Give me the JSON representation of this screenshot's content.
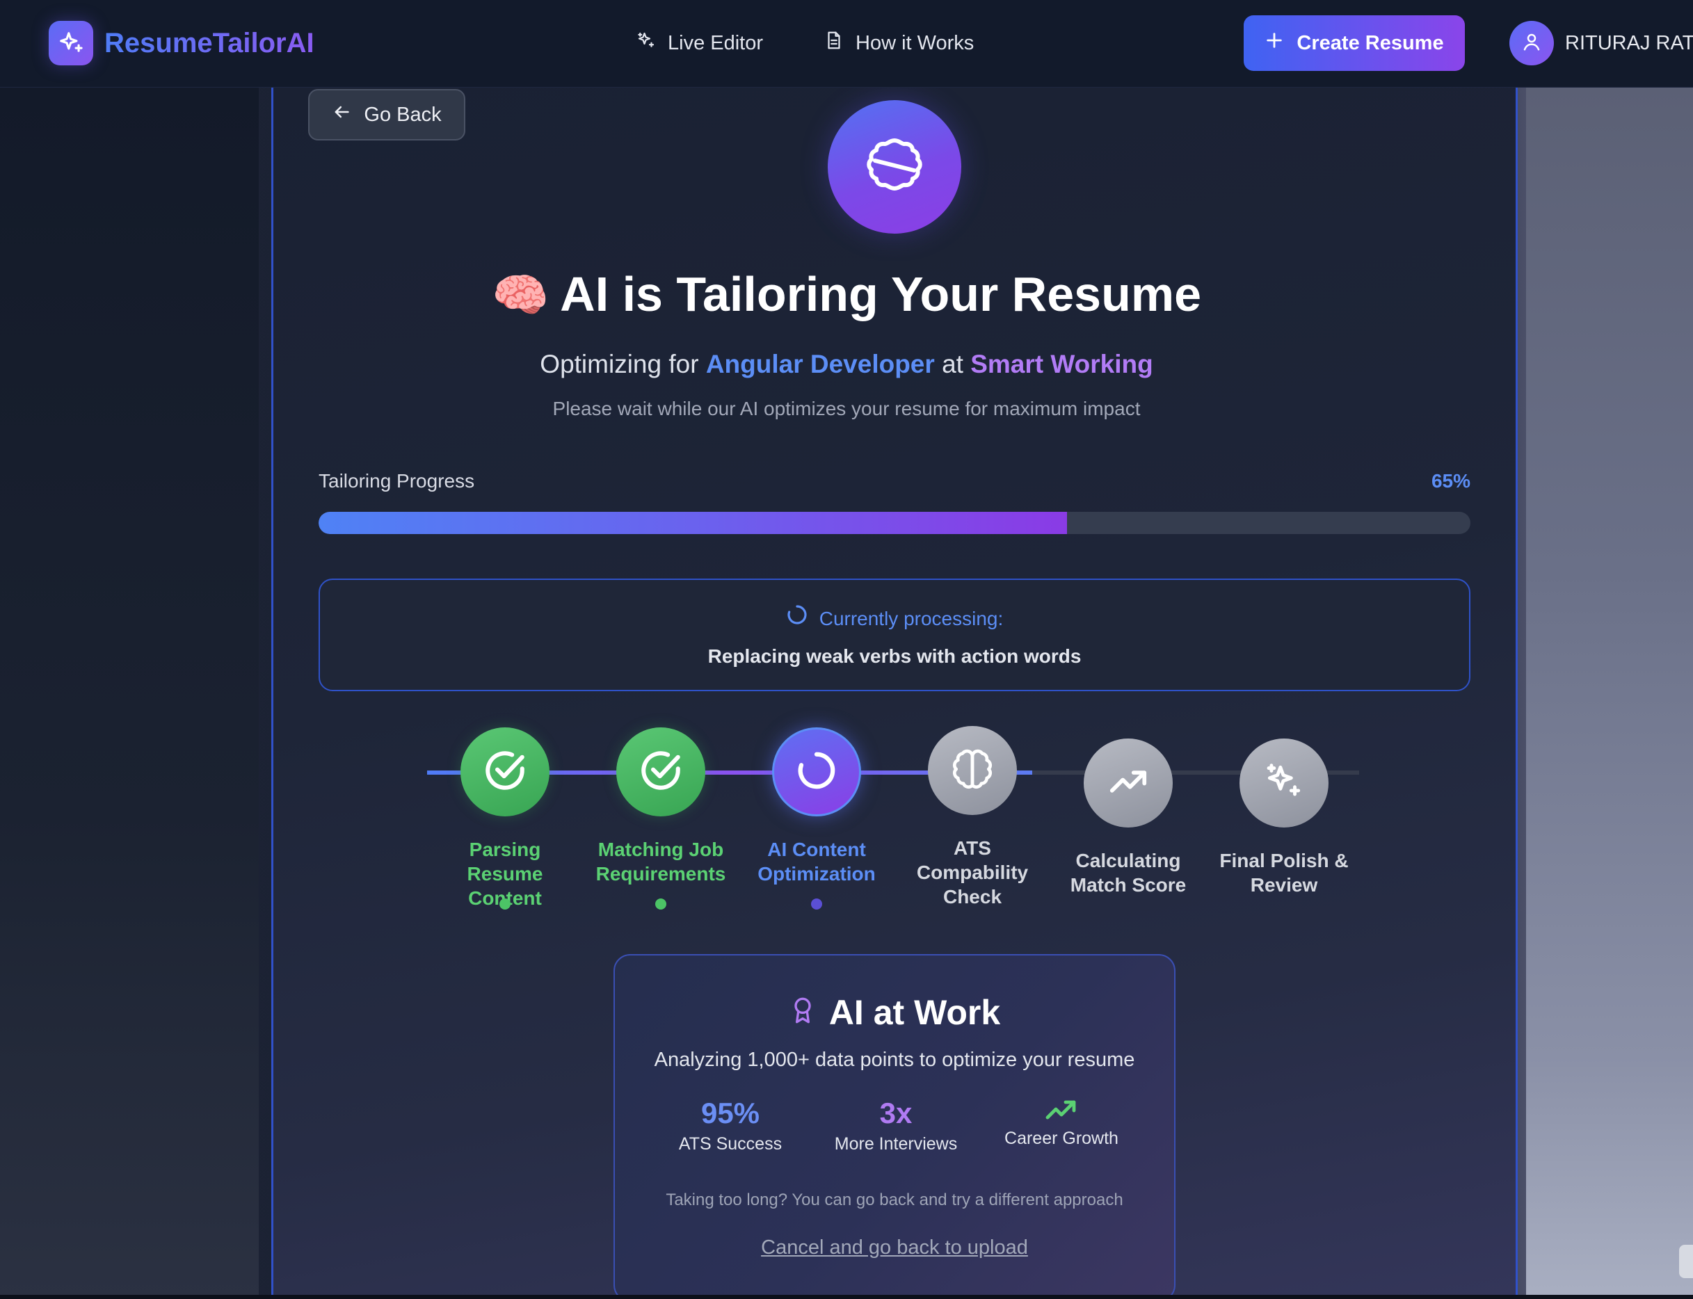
{
  "brand": {
    "name": "ResumeTailorAI"
  },
  "nav": {
    "links": [
      {
        "label": "Live Editor",
        "icon": "sparkles-icon"
      },
      {
        "label": "How it Works",
        "icon": "document-icon"
      }
    ],
    "create_label": "Create Resume",
    "user_name": "RITURAJ RATAN"
  },
  "page": {
    "go_back_label": "Go Back",
    "title_emoji": "🧠",
    "title": "AI is Tailoring Your Resume",
    "subtitle_prefix": "Optimizing for",
    "subtitle_role": "Angular Developer",
    "subtitle_mid": "at",
    "subtitle_company": "Smart Working",
    "wait_text": "Please wait while our AI optimizes your resume for maximum impact"
  },
  "progress": {
    "label": "Tailoring Progress",
    "percent_text": "65%",
    "value": 0.65
  },
  "processing": {
    "heading": "Currently processing:",
    "text": "Replacing weak verbs with action words"
  },
  "steps": [
    {
      "label_line1": "Parsing Resume",
      "label_line2": "Content",
      "status": "done"
    },
    {
      "label_line1": "Matching Job",
      "label_line2": "Requirements",
      "status": "done"
    },
    {
      "label_line1": "AI Content",
      "label_line2": "Optimization",
      "status": "active"
    },
    {
      "label_line1": "ATS",
      "label_line2": "Compability",
      "label_line3": "Check",
      "status": "pending"
    },
    {
      "label_line1": "Calculating",
      "label_line2": "Match Score",
      "status": "pending"
    },
    {
      "label_line1": "Final Polish &",
      "label_line2": "Review",
      "status": "pending"
    }
  ],
  "ai_card": {
    "title": "AI at Work",
    "description": "Analyzing 1,000+ data points to optimize your resume",
    "stats": [
      {
        "value": "95%",
        "label": "ATS Success",
        "color": "#6b8ff5"
      },
      {
        "value": "3x",
        "label": "More Interviews",
        "color": "#b07bf3"
      },
      {
        "value": "",
        "label": "Career Growth",
        "color": "#5bd173",
        "icon": "trending-up-icon"
      }
    ],
    "note": "Taking too long? You can go back and try a different approach",
    "cancel_label": "Cancel and go back to upload"
  },
  "colors": {
    "accent_blue": "#5c8ef6",
    "accent_purple": "#b27cf6",
    "success_green": "#5bd173",
    "panel_border": "#3151c9"
  }
}
